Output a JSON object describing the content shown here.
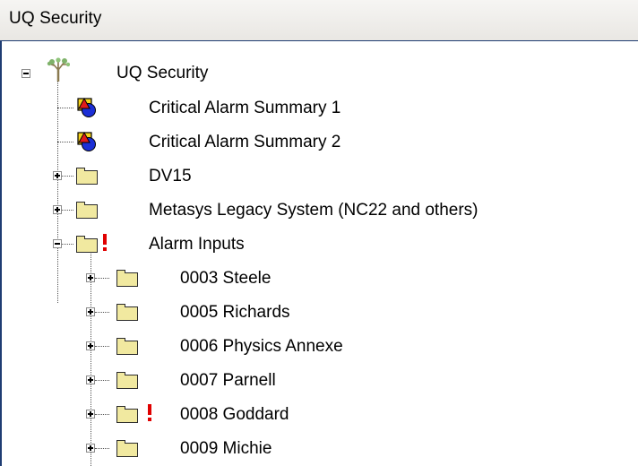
{
  "window": {
    "title": "UQ Security"
  },
  "tree": {
    "root": {
      "label": "UQ Security",
      "icon": "tree-icon",
      "expanded": true
    },
    "items": [
      {
        "label": "Critical Alarm Summary 1",
        "icon": "alarm-summary-icon"
      },
      {
        "label": "Critical Alarm Summary 2",
        "icon": "alarm-summary-icon"
      },
      {
        "label": "DV15",
        "icon": "folder-icon",
        "expanded": false
      },
      {
        "label": "Metasys Legacy System (NC22 and others)",
        "icon": "folder-icon",
        "expanded": false
      },
      {
        "label": "Alarm Inputs",
        "icon": "folder-icon",
        "expanded": true,
        "alarm": true,
        "children": [
          {
            "label": "0003 Steele",
            "icon": "folder-icon",
            "expanded": false
          },
          {
            "label": "0005 Richards",
            "icon": "folder-icon",
            "expanded": false
          },
          {
            "label": "0006 Physics Annexe",
            "icon": "folder-icon",
            "expanded": false
          },
          {
            "label": "0007 Parnell",
            "icon": "folder-icon",
            "expanded": false
          },
          {
            "label": "0008 Goddard",
            "icon": "folder-icon",
            "expanded": false,
            "alarm": true
          },
          {
            "label": "0009 Michie",
            "icon": "folder-icon",
            "expanded": false
          }
        ]
      }
    ]
  },
  "colors": {
    "folder": "#f1e9a0",
    "alarm": "#e00000",
    "border": "#1f3d73"
  }
}
